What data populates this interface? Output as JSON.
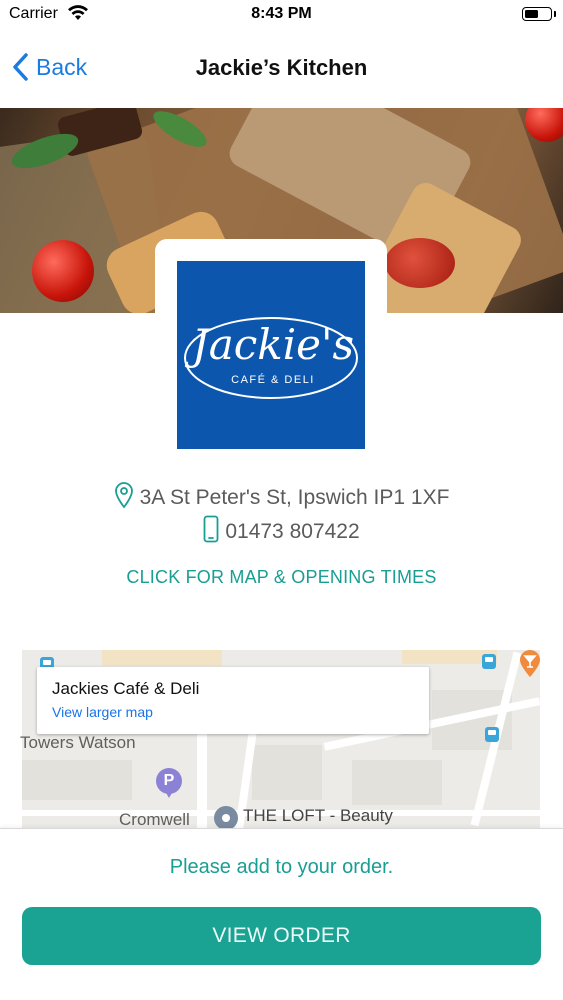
{
  "status_bar": {
    "carrier": "Carrier",
    "time": "8:43 PM",
    "battery_level": 0.55,
    "icons": [
      "wifi-icon",
      "battery-icon"
    ]
  },
  "nav": {
    "back_label": "Back",
    "title": "Jackie’s Kitchen",
    "icons": [
      "chevron-left-icon"
    ]
  },
  "hero": {
    "description_icon": "food-photo"
  },
  "logo": {
    "line1": "Jackie's",
    "line2": "CAFÉ & DELI",
    "brand_color": "#0d56ad"
  },
  "contact": {
    "address": "3A St Peter's St, Ipswich IP1 1XF",
    "phone": "01473 807422",
    "icons": [
      "location-pin-icon",
      "mobile-phone-icon"
    ],
    "link_label": "CLICK FOR MAP & OPENING TIMES",
    "accent_color": "#199e93"
  },
  "map": {
    "card_title": "Jackies Café & Deli",
    "card_link": "View larger map",
    "labels": {
      "towers_watson": "Towers Watson",
      "cromwell": "Cromwell",
      "the_loft": "THE LOFT - Beauty",
      "parking": "P"
    }
  },
  "order": {
    "prompt": "Please add to your order.",
    "button_label": "VIEW ORDER",
    "button_color": "#1aa293"
  }
}
